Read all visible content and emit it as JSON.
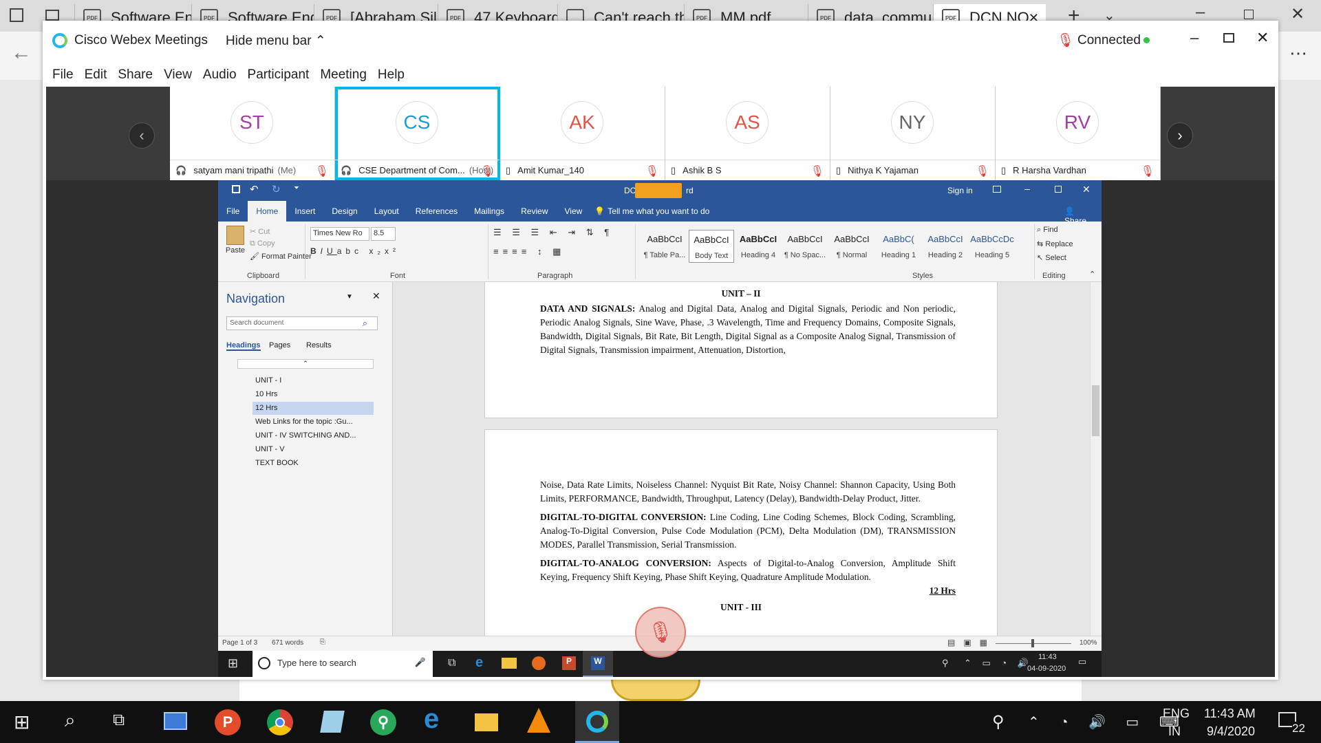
{
  "browser_tabs": [
    {
      "label": "Software Engi",
      "icon": "pdf-icon",
      "active": false
    },
    {
      "label": "Software Eng",
      "icon": "pdf-icon",
      "active": false
    },
    {
      "label": "[Abraham Sil",
      "icon": "pdf-icon",
      "active": false
    },
    {
      "label": "47 Keyboard",
      "icon": "pdf-icon",
      "active": false
    },
    {
      "label": "Can't reach th",
      "icon": "page-icon",
      "active": false
    },
    {
      "label": "MM.pdf",
      "icon": "pdf-icon",
      "active": false
    },
    {
      "label": "data_commu",
      "icon": "pdf-icon",
      "active": false
    },
    {
      "label": "DCN NO",
      "icon": "pdf-icon",
      "active": true
    }
  ],
  "webex": {
    "app_title": "Cisco Webex Meetings",
    "hide_menu": "Hide menu bar",
    "status": "Connected",
    "menu": [
      "File",
      "Edit",
      "Share",
      "View",
      "Audio",
      "Participant",
      "Meeting",
      "Help"
    ],
    "participants": [
      {
        "initials": "ST",
        "name": "satyam mani tripathi",
        "tag": "(Me)",
        "color": "#a23fa2"
      },
      {
        "initials": "CS",
        "name": "CSE Department of Com...",
        "tag": "(Host)",
        "color": "#1d9bd6"
      },
      {
        "initials": "AK",
        "name": "Amit Kumar_140",
        "tag": "",
        "color": "#e0544a"
      },
      {
        "initials": "AS",
        "name": "Ashik B S",
        "tag": "",
        "color": "#e0544a"
      },
      {
        "initials": "NY",
        "name": "Nithya K Yajaman",
        "tag": "",
        "color": "#666666"
      },
      {
        "initials": "RV",
        "name": "R Harsha Vardhan",
        "tag": "",
        "color": "#a23fa2"
      }
    ]
  },
  "word": {
    "title_left": "DC",
    "title_right": "rd",
    "sign_in": "Sign in",
    "tabs": [
      "File",
      "Home",
      "Insert",
      "Design",
      "Layout",
      "References",
      "Mailings",
      "Review",
      "View"
    ],
    "tell_me": "Tell me what you want to do",
    "share": "Share",
    "clipboard": {
      "paste": "Paste",
      "cut": "Cut",
      "copy": "Copy",
      "format_painter": "Format Painter",
      "label": "Clipboard"
    },
    "font": {
      "name": "Times New Ro",
      "size": "8.5",
      "label": "Font"
    },
    "paragraph_label": "Paragraph",
    "styles": [
      {
        "sample": "AaBbCcI",
        "name": "¶ Table Pa..."
      },
      {
        "sample": "AaBbCcI",
        "name": "Body Text"
      },
      {
        "sample": "AaBbCcI",
        "name": "Heading 4"
      },
      {
        "sample": "AaBbCcI",
        "name": "¶ No Spac..."
      },
      {
        "sample": "AaBbCcI",
        "name": "¶ Normal"
      },
      {
        "sample": "AaBbC(",
        "name": "Heading 1"
      },
      {
        "sample": "AaBbCcI",
        "name": "Heading 2"
      },
      {
        "sample": "AaBbCcDc",
        "name": "Heading 5"
      }
    ],
    "styles_label": "Styles",
    "editing": {
      "find": "Find",
      "replace": "Replace",
      "select": "Select",
      "label": "Editing"
    },
    "navigation": {
      "title": "Navigation",
      "search_placeholder": "Search document",
      "tabs": [
        "Headings",
        "Pages",
        "Results"
      ],
      "items": [
        "UNIT - I",
        "10 Hrs",
        "12 Hrs",
        "Web Links for the topic :Gu...",
        "UNIT - IV SWITCHING AND...",
        "UNIT - V",
        "TEXT BOOK"
      ],
      "selected_index": 2
    },
    "doc": {
      "unit2": "UNIT – II",
      "p1_bold": "DATA AND SIGNALS:",
      "p1": " Analog and Digital Data, Analog and Digital Signals, Periodic and Non periodic, Periodic Analog Signals, Sine Wave, Phase, .3 Wavelength, Time and Frequency Domains, Composite Signals, Bandwidth, Digital Signals, Bit Rate, Bit Length, Digital Signal as a Composite Analog Signal, Transmission of Digital Signals, Transmission impairment, Attenuation, Distortion,",
      "p2": "Noise, Data Rate Limits, Noiseless Channel: Nyquist Bit Rate, Noisy Channel: Shannon Capacity, Using Both Limits, PERFORMANCE, Bandwidth, Throughput, Latency (Delay), Bandwidth-Delay Product, Jitter.",
      "p3_bold": "DIGITAL-TO-DIGITAL CONVERSION:",
      "p3": " Line Coding, Line Coding Schemes, Block Coding, Scrambling, Analog-To-Digital Conversion, Pulse Code Modulation (PCM), Delta Modulation (DM), TRANSMISSION MODES, Parallel Transmission, Serial Transmission.",
      "p4_bold": "DIGITAL-TO-ANALOG CONVERSION:",
      "p4": " Aspects of Digital-to-Analog Conversion, Amplitude Shift Keying, Frequency Shift Keying, Phase Shift Keying, Quadrature Amplitude Modulation.",
      "hrs": "12 Hrs",
      "unit3": "UNIT - III"
    },
    "status": {
      "page": "Page 1 of 3",
      "words": "671 words",
      "zoom": "100%"
    }
  },
  "inner_taskbar": {
    "search": "Type here to search",
    "time": "11:43",
    "date": "04-09-2020"
  },
  "taskbar": {
    "lang1": "ENG",
    "lang2": "IN",
    "time": "11:43 AM",
    "date": "9/4/2020",
    "notif": "22"
  }
}
